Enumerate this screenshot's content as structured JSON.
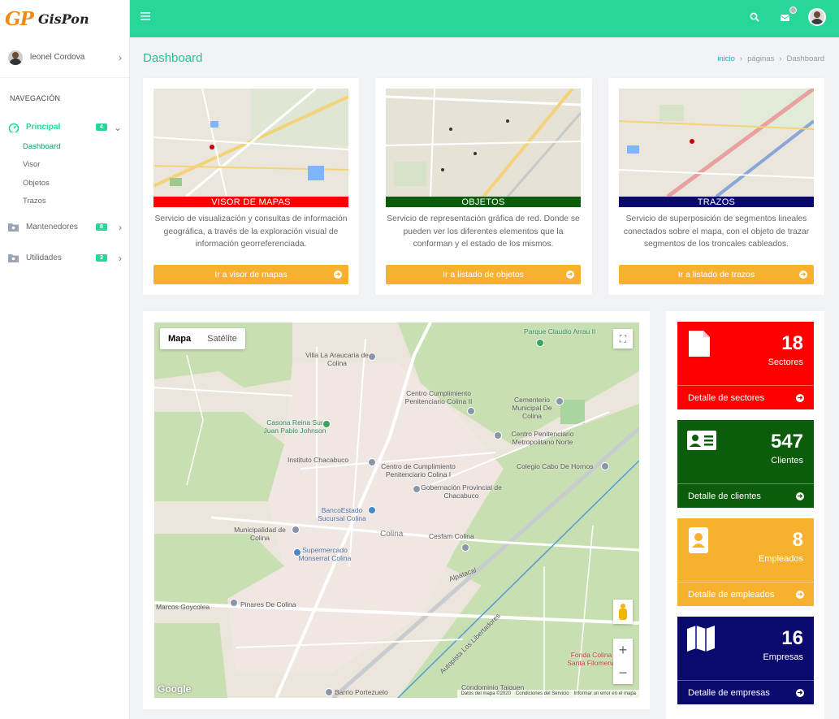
{
  "app": {
    "logo_mark": "GP",
    "logo_name": "GisPon"
  },
  "topbar": {
    "menu_icon": "hamburger-icon",
    "icons": [
      "search-icon",
      "notification-icon",
      "user-avatar"
    ]
  },
  "sidebar": {
    "user_name": "leonel Cordova",
    "nav_title": "NAVEGACIÓN",
    "sections": [
      {
        "label": "Principal",
        "badge": "4",
        "icon": "dashboard-gauge-icon",
        "expanded": true,
        "items": [
          "Dashboard",
          "Visor",
          "Objetos",
          "Trazos"
        ]
      },
      {
        "label": "Mantenedores",
        "badge": "8",
        "icon": "folder-icon"
      },
      {
        "label": "Utilidades",
        "badge": "3",
        "icon": "folder-icon"
      }
    ]
  },
  "page": {
    "title": "Dashboard"
  },
  "breadcrumb": [
    "inicio",
    "páginas",
    "Dashboard"
  ],
  "services": [
    {
      "title": "VISOR DE MAPAS",
      "color": "#ff0000",
      "description": "Servicio de visualización y consultas de información geográfica, a través de la exploración visual de información georreferenciada.",
      "button": "Ir a visor de mapas"
    },
    {
      "title": "OBJETOS",
      "color": "#0b5d0b",
      "description": "Servicio de representación gráfica de red. Donde se pueden ver los diferentes elementos que la conforman y el estado de los mismos.",
      "button": "Ir a listado de objetos"
    },
    {
      "title": "TRAZOS",
      "color": "#0a0a6e",
      "description": "Servicio de superposición de segmentos lineales conectados sobre el mapa, con el objeto de trazar segmentos de los troncales cableados.",
      "button": "Ir a listado de trazos"
    }
  ],
  "map": {
    "type_options": [
      "Mapa",
      "Satélite"
    ],
    "selected_type": "Mapa",
    "attribution": [
      "Datos del mapa ©2020",
      "Condiciones del Servicio",
      "Informar un error en el mapa"
    ],
    "google": "Google",
    "labels": [
      "Parque Claudio Arrau II",
      "Villa La Araucaria de Colina",
      "Centro Cumplimiento Penitenciario Colina II",
      "Cementerio Municipal De Colina",
      "Casona Reina Sur Juan Pablo Johnson",
      "Centro Penitenciario Metropolitano Norte",
      "Instituto Chacabuco",
      "Centro de Cumplimiento Penitenciario Colina I",
      "Colegio Cabo De Hornos",
      "Gobernación Provincial de Chacabuco",
      "BancoEstado Sucursal Colina",
      "Municipalidad de Colina",
      "Cesfam Colina",
      "Colina",
      "Supermercado Monserrat Colina",
      "Pinares De Colina",
      "Marcos Goycolea",
      "Fonda Colina Santa Filomena",
      "Condominio Taiquen",
      "Barrio Portezuelo",
      "Autopista Los Libertadores",
      "Alpatacal"
    ]
  },
  "stats": [
    {
      "value": "18",
      "label": "Sectores",
      "link": "Detalle de sectores",
      "color": "#ff0000",
      "icon": "document-icon"
    },
    {
      "value": "547",
      "label": "Clientes",
      "link": "Detalle de clientes",
      "color": "#0b5d0b",
      "icon": "id-card-icon"
    },
    {
      "value": "8",
      "label": "Empleados",
      "link": "Detalle de empleados",
      "color": "#f8b12e",
      "icon": "contact-book-icon"
    },
    {
      "value": "16",
      "label": "Empresas",
      "link": "Detalle de empresas",
      "color": "#0a0a6e",
      "icon": "map-icon"
    }
  ]
}
